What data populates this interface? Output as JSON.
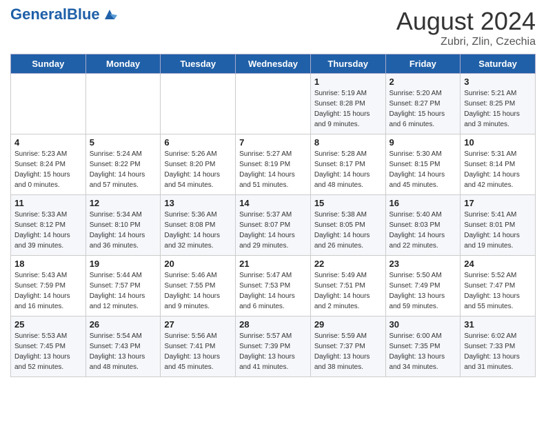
{
  "header": {
    "logo_general": "General",
    "logo_blue": "Blue",
    "main_title": "August 2024",
    "subtitle": "Zubri, Zlin, Czechia"
  },
  "days_of_week": [
    "Sunday",
    "Monday",
    "Tuesday",
    "Wednesday",
    "Thursday",
    "Friday",
    "Saturday"
  ],
  "weeks": [
    [
      {
        "day": "",
        "info": ""
      },
      {
        "day": "",
        "info": ""
      },
      {
        "day": "",
        "info": ""
      },
      {
        "day": "",
        "info": ""
      },
      {
        "day": "1",
        "info": "Sunrise: 5:19 AM\nSunset: 8:28 PM\nDaylight: 15 hours\nand 9 minutes."
      },
      {
        "day": "2",
        "info": "Sunrise: 5:20 AM\nSunset: 8:27 PM\nDaylight: 15 hours\nand 6 minutes."
      },
      {
        "day": "3",
        "info": "Sunrise: 5:21 AM\nSunset: 8:25 PM\nDaylight: 15 hours\nand 3 minutes."
      }
    ],
    [
      {
        "day": "4",
        "info": "Sunrise: 5:23 AM\nSunset: 8:24 PM\nDaylight: 15 hours\nand 0 minutes."
      },
      {
        "day": "5",
        "info": "Sunrise: 5:24 AM\nSunset: 8:22 PM\nDaylight: 14 hours\nand 57 minutes."
      },
      {
        "day": "6",
        "info": "Sunrise: 5:26 AM\nSunset: 8:20 PM\nDaylight: 14 hours\nand 54 minutes."
      },
      {
        "day": "7",
        "info": "Sunrise: 5:27 AM\nSunset: 8:19 PM\nDaylight: 14 hours\nand 51 minutes."
      },
      {
        "day": "8",
        "info": "Sunrise: 5:28 AM\nSunset: 8:17 PM\nDaylight: 14 hours\nand 48 minutes."
      },
      {
        "day": "9",
        "info": "Sunrise: 5:30 AM\nSunset: 8:15 PM\nDaylight: 14 hours\nand 45 minutes."
      },
      {
        "day": "10",
        "info": "Sunrise: 5:31 AM\nSunset: 8:14 PM\nDaylight: 14 hours\nand 42 minutes."
      }
    ],
    [
      {
        "day": "11",
        "info": "Sunrise: 5:33 AM\nSunset: 8:12 PM\nDaylight: 14 hours\nand 39 minutes."
      },
      {
        "day": "12",
        "info": "Sunrise: 5:34 AM\nSunset: 8:10 PM\nDaylight: 14 hours\nand 36 minutes."
      },
      {
        "day": "13",
        "info": "Sunrise: 5:36 AM\nSunset: 8:08 PM\nDaylight: 14 hours\nand 32 minutes."
      },
      {
        "day": "14",
        "info": "Sunrise: 5:37 AM\nSunset: 8:07 PM\nDaylight: 14 hours\nand 29 minutes."
      },
      {
        "day": "15",
        "info": "Sunrise: 5:38 AM\nSunset: 8:05 PM\nDaylight: 14 hours\nand 26 minutes."
      },
      {
        "day": "16",
        "info": "Sunrise: 5:40 AM\nSunset: 8:03 PM\nDaylight: 14 hours\nand 22 minutes."
      },
      {
        "day": "17",
        "info": "Sunrise: 5:41 AM\nSunset: 8:01 PM\nDaylight: 14 hours\nand 19 minutes."
      }
    ],
    [
      {
        "day": "18",
        "info": "Sunrise: 5:43 AM\nSunset: 7:59 PM\nDaylight: 14 hours\nand 16 minutes."
      },
      {
        "day": "19",
        "info": "Sunrise: 5:44 AM\nSunset: 7:57 PM\nDaylight: 14 hours\nand 12 minutes."
      },
      {
        "day": "20",
        "info": "Sunrise: 5:46 AM\nSunset: 7:55 PM\nDaylight: 14 hours\nand 9 minutes."
      },
      {
        "day": "21",
        "info": "Sunrise: 5:47 AM\nSunset: 7:53 PM\nDaylight: 14 hours\nand 6 minutes."
      },
      {
        "day": "22",
        "info": "Sunrise: 5:49 AM\nSunset: 7:51 PM\nDaylight: 14 hours\nand 2 minutes."
      },
      {
        "day": "23",
        "info": "Sunrise: 5:50 AM\nSunset: 7:49 PM\nDaylight: 13 hours\nand 59 minutes."
      },
      {
        "day": "24",
        "info": "Sunrise: 5:52 AM\nSunset: 7:47 PM\nDaylight: 13 hours\nand 55 minutes."
      }
    ],
    [
      {
        "day": "25",
        "info": "Sunrise: 5:53 AM\nSunset: 7:45 PM\nDaylight: 13 hours\nand 52 minutes."
      },
      {
        "day": "26",
        "info": "Sunrise: 5:54 AM\nSunset: 7:43 PM\nDaylight: 13 hours\nand 48 minutes."
      },
      {
        "day": "27",
        "info": "Sunrise: 5:56 AM\nSunset: 7:41 PM\nDaylight: 13 hours\nand 45 minutes."
      },
      {
        "day": "28",
        "info": "Sunrise: 5:57 AM\nSunset: 7:39 PM\nDaylight: 13 hours\nand 41 minutes."
      },
      {
        "day": "29",
        "info": "Sunrise: 5:59 AM\nSunset: 7:37 PM\nDaylight: 13 hours\nand 38 minutes."
      },
      {
        "day": "30",
        "info": "Sunrise: 6:00 AM\nSunset: 7:35 PM\nDaylight: 13 hours\nand 34 minutes."
      },
      {
        "day": "31",
        "info": "Sunrise: 6:02 AM\nSunset: 7:33 PM\nDaylight: 13 hours\nand 31 minutes."
      }
    ]
  ]
}
